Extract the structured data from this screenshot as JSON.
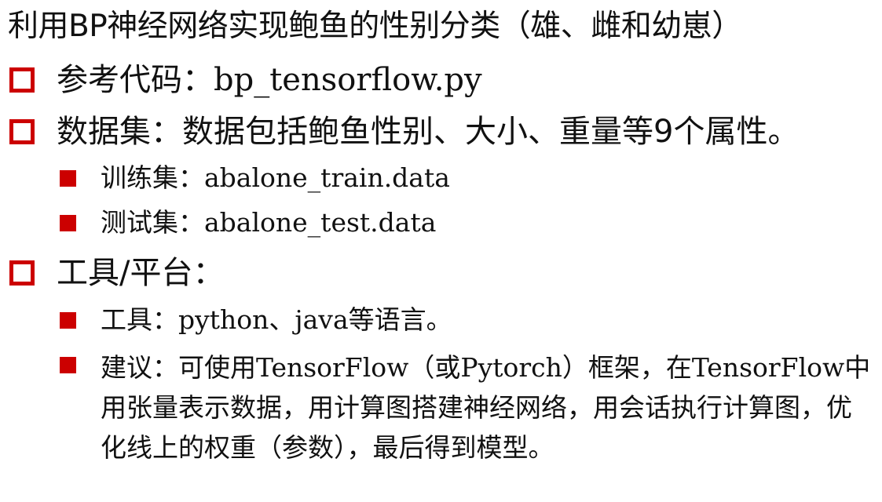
{
  "title": "利用BP神经网络实现鲍鱼的性别分类（雄、雌和幼崽）",
  "items": [
    {
      "label": "参考代码：",
      "value": "bp_tensorflow.py"
    },
    {
      "label": "数据集：",
      "value": "数据包括鲍鱼性别、大小、重量等9个属性。"
    },
    {
      "label": "工具/平台："
    }
  ],
  "dataset": {
    "train_label": "训练集：",
    "train_value": "abalone_train.data",
    "test_label": "测试集：",
    "test_value": "abalone_test.data"
  },
  "tools": {
    "tool_label": "工具：",
    "tool_value": "python、java等语言。",
    "advice": "建议：可使用TensorFlow（或Pytorch）框架，在TensorFlow中用张量表示数据，用计算图搭建神经网络，用会话执行计算图，优化线上的权重（参数），最后得到模型。"
  },
  "colors": {
    "bullet": "#cc0000",
    "text": "#111111"
  },
  "icons": {
    "level1_bullet": "hollow-square-icon",
    "level2_bullet": "filled-square-icon"
  }
}
